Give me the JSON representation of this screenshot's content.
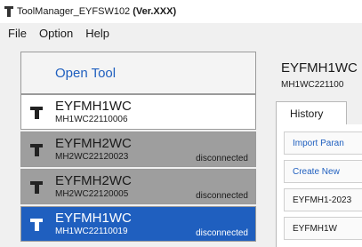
{
  "window": {
    "title_main": "ToolManager_EYFSW102",
    "title_version": "(Ver.XXX)"
  },
  "menu": [
    "File",
    "Option",
    "Help"
  ],
  "left_panel": {
    "open_tool_label": "Open Tool",
    "tools": [
      {
        "model": "EYFMH1WC",
        "serial": "MH1WC22110006",
        "status": "",
        "state": "connected"
      },
      {
        "model": "EYFMH2WC",
        "serial": "MH2WC22120023",
        "status": "disconnected",
        "state": "disconnected"
      },
      {
        "model": "EYFMH2WC",
        "serial": "MH2WC22120005",
        "status": "disconnected",
        "state": "disconnected"
      },
      {
        "model": "EYFMH1WC",
        "serial": "MH1WC22110019",
        "status": "disconnected",
        "state": "selected"
      }
    ]
  },
  "right_panel": {
    "model": "EYFMH1WC",
    "serial": "MH1WC221100",
    "tab_label": "History",
    "rows": [
      "Import Paran",
      "Create New",
      "EYFMH1-2023",
      "EYFMH1W"
    ]
  },
  "colors": {
    "accent": "#1f5fbf",
    "disconnected_bg": "#9e9e9e",
    "selected_bg": "#1f5fbf"
  }
}
